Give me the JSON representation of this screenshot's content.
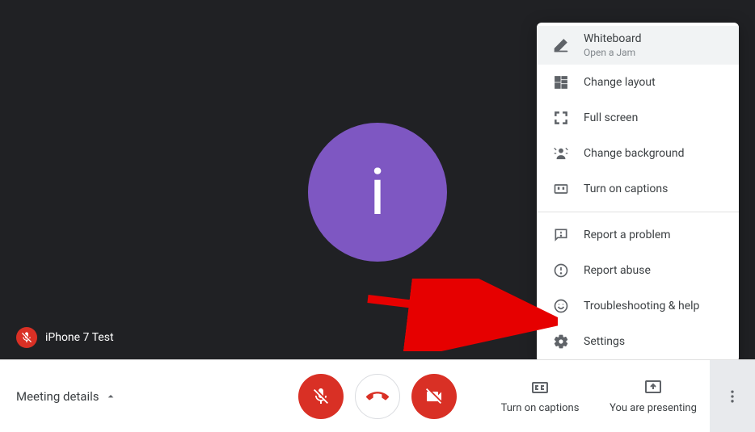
{
  "participant": {
    "name": "iPhone 7 Test",
    "initial": "i"
  },
  "bottomBar": {
    "meetingDetails": "Meeting details",
    "captions": "Turn on captions",
    "presenting": "You are presenting"
  },
  "menu": {
    "whiteboard": {
      "label": "Whiteboard",
      "sub": "Open a Jam"
    },
    "changeLayout": "Change layout",
    "fullScreen": "Full screen",
    "changeBackground": "Change background",
    "turnOnCaptions": "Turn on captions",
    "reportProblem": "Report a problem",
    "reportAbuse": "Report abuse",
    "troubleshooting": "Troubleshooting & help",
    "settings": "Settings"
  }
}
